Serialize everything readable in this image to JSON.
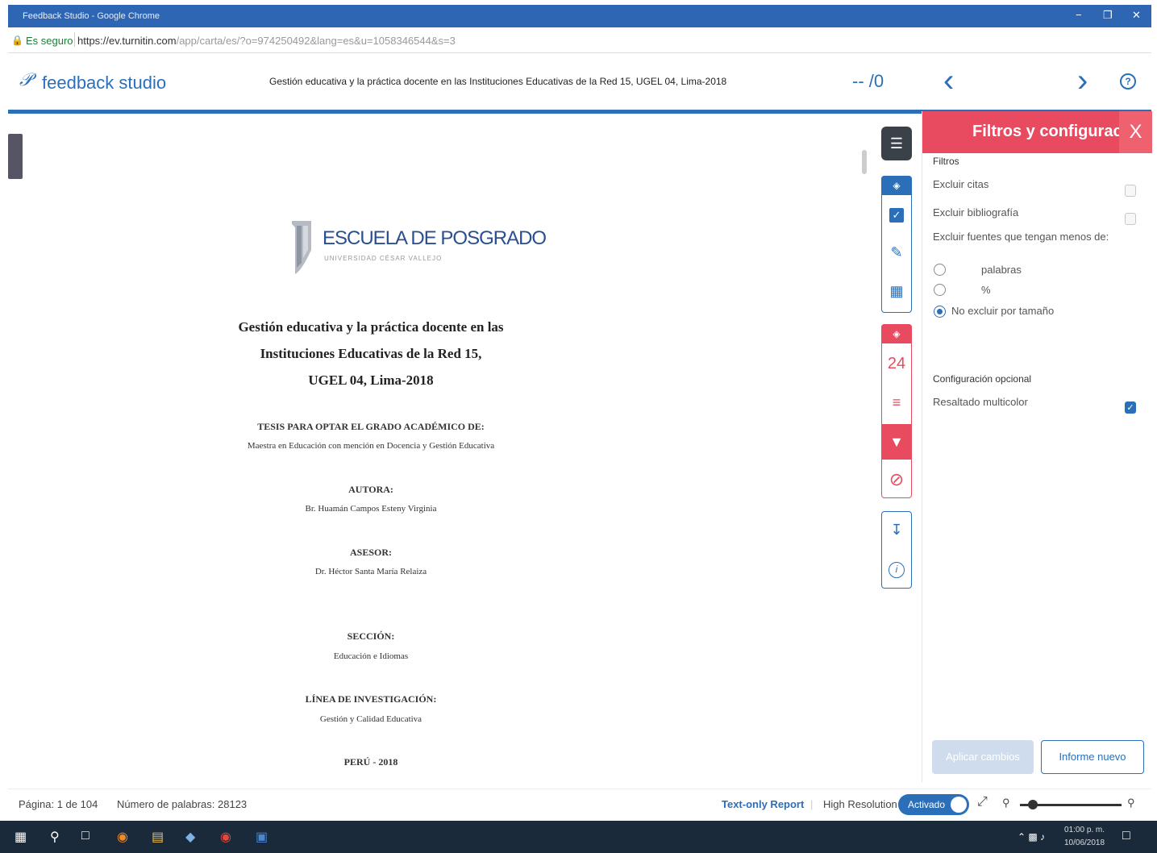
{
  "window": {
    "title": "Feedback Studio - Google Chrome",
    "minimize": "−",
    "restore": "❐",
    "close": "✕"
  },
  "address": {
    "secure_label": "Es seguro",
    "url_main": "https://ev.turnitin.com",
    "url_rest": "/app/carta/es/?o=974250492&lang=es&u=1058346544&s=3"
  },
  "app": {
    "logo": "feedback studio",
    "doc_title": "Gestión educativa y la práctica docente en las Instituciones Educativas de la Red 15, UGEL 04, Lima-2018",
    "page_indicator": "-- /0"
  },
  "document": {
    "brand_name": "ESCUELA DE POSGRADO",
    "brand_sub": "UNIVERSIDAD CÉSAR VALLEJO",
    "title_lines": [
      "Gestión educativa y la práctica docente en las",
      "Instituciones Educativas de la Red 15,",
      "UGEL 04, Lima-2018"
    ],
    "thesis_label": "TESIS PARA OPTAR EL GRADO ACADÉMICO DE:",
    "degree": "Maestra en Educación con mención en Docencia y Gestión Educativa",
    "author_label": "AUTORA:",
    "author": "Br. Huamán Campos Esteny Virginia",
    "advisor_label": "ASESOR:",
    "advisor": "Dr. Héctor Santa María Relaiza",
    "section_label": "SECCIÓN:",
    "section": "Educación e Idiomas",
    "line_label": "LÍNEA DE INVESTIGACIÓN:",
    "line": "Gestión y Calidad Educativa",
    "footer": "PERÚ - 2018"
  },
  "toolbar": {
    "similarity_count": "24"
  },
  "panel": {
    "title": "Filtros y configuración",
    "close": "X",
    "filters_heading": "Filtros",
    "exclude_quotes": "Excluir citas",
    "exclude_bibliography": "Excluir bibliografía",
    "exclude_small": "Excluir fuentes que tengan menos de:",
    "opt_words": "palabras",
    "opt_percent": "%",
    "opt_no_exclude": "No excluir por tamaño",
    "optional_heading": "Configuración opcional",
    "multicolor": "Resaltado multicolor",
    "apply_button": "Aplicar cambios",
    "new_report_button": "Informe nuevo",
    "states": {
      "exclude_quotes": false,
      "exclude_bibliography": false,
      "size_option": "No excluir por tamaño",
      "multicolor": true
    }
  },
  "status": {
    "page": "Página: 1 de 104",
    "word_count": "Número de palabras: 28123",
    "text_only_report": "Text-only Report",
    "high_resolution": "High Resolution",
    "toggle_state": "Activado"
  },
  "taskbar": {
    "time": "01:00 p. m.",
    "date": "10/06/2018"
  },
  "colors": {
    "brand_blue": "#2a6fb8",
    "panel_red": "#e84a5f",
    "title_bar": "#2f66b3"
  }
}
